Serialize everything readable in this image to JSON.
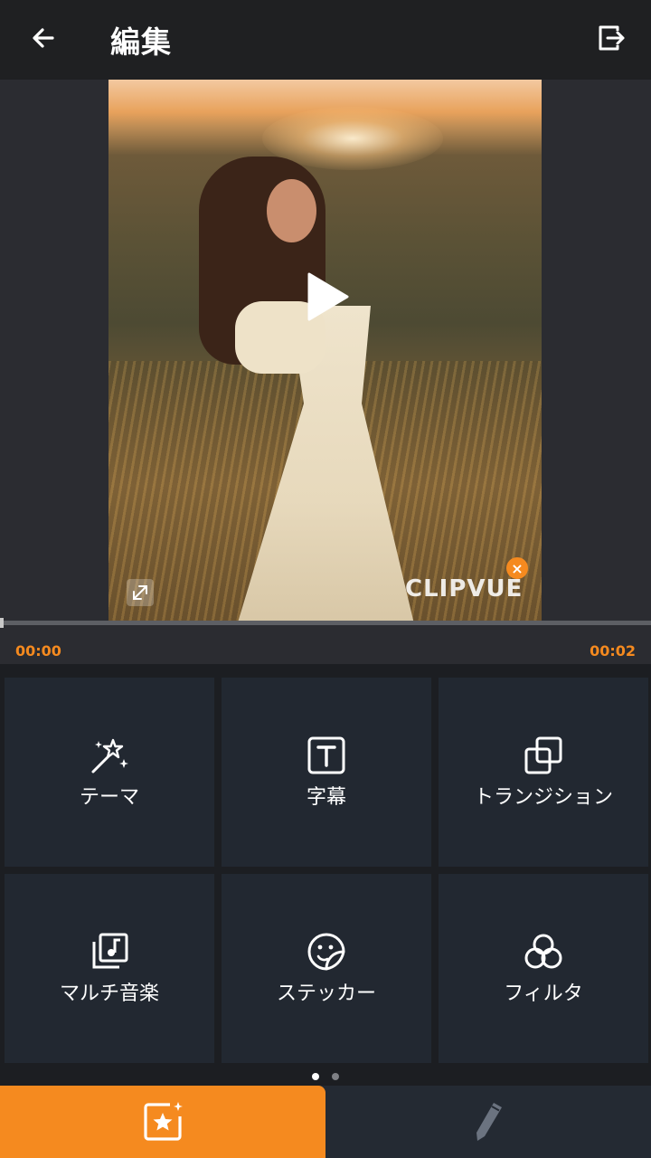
{
  "header": {
    "title": "編集",
    "back_icon": "arrow-left-icon",
    "export_icon": "export-icon"
  },
  "preview": {
    "watermark": "CLIPVUE",
    "watermark_close": "×",
    "play_icon": "play-icon",
    "fullscreen_icon": "expand-icon"
  },
  "timeline": {
    "start_time": "00:00",
    "end_time": "00:02",
    "progress": 0.0
  },
  "tools": [
    {
      "label": "テーマ",
      "icon": "magic-wand-icon"
    },
    {
      "label": "字幕",
      "icon": "text-box-icon"
    },
    {
      "label": "トランジション",
      "icon": "transition-icon"
    },
    {
      "label": "マルチ音楽",
      "icon": "music-library-icon"
    },
    {
      "label": "ステッカー",
      "icon": "sticker-icon"
    },
    {
      "label": "フィルタ",
      "icon": "filter-circles-icon"
    }
  ],
  "pager": {
    "count": 2,
    "active": 0
  },
  "bottom_tabs": [
    {
      "icon": "star-frame-icon",
      "active": true
    },
    {
      "icon": "pencil-icon",
      "active": false
    }
  ],
  "colors": {
    "accent": "#f58a1f",
    "tile_bg": "#222831",
    "header_bg": "#1f2022",
    "preview_bg": "#2b2c31"
  }
}
